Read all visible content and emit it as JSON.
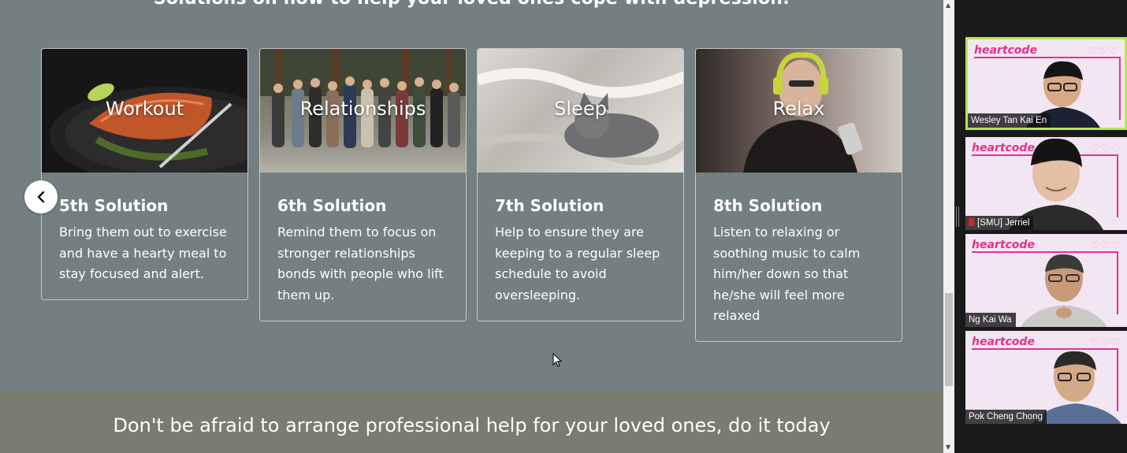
{
  "page": {
    "heading": "Solutions on how to help your loved ones cope with depression:",
    "cards": [
      {
        "image_title": "Workout",
        "title": "5th Solution",
        "text": "Bring them out to exercise and have a hearty meal to stay focused and alert."
      },
      {
        "image_title": "Relationships",
        "title": "6th Solution",
        "text": "Remind them to focus on stronger relationships bonds with people who lift them up."
      },
      {
        "image_title": "Sleep",
        "title": "7th Solution",
        "text": "Help to ensure they are keeping to a regular sleep schedule to avoid oversleeping."
      },
      {
        "image_title": "Relax",
        "title": "8th Solution",
        "text": "Listen to relaxing or soothing music to calm him/her down so that he/she will feel more relaxed"
      }
    ],
    "prev_icon": "chevron-left-icon",
    "footer_text": "Don't be afraid to arrange professional help for your loved ones, do it today"
  },
  "video": {
    "logo_text": "heartcode",
    "hearts": "♡♡♡",
    "participants": [
      {
        "name": "Wesley Tan Kai En",
        "recording": false,
        "active": true
      },
      {
        "name": "[SMU] Jerriel",
        "recording": true,
        "active": false
      },
      {
        "name": "Ng Kai Wa",
        "recording": false,
        "active": false
      },
      {
        "name": "Pok Cheng Chong",
        "recording": false,
        "active": false
      }
    ]
  },
  "colors": {
    "page_bg": "#737f80",
    "footer_bg": "#7b7b70",
    "active_speaker": "#b5e84c",
    "brand_pink": "#e2338e"
  }
}
